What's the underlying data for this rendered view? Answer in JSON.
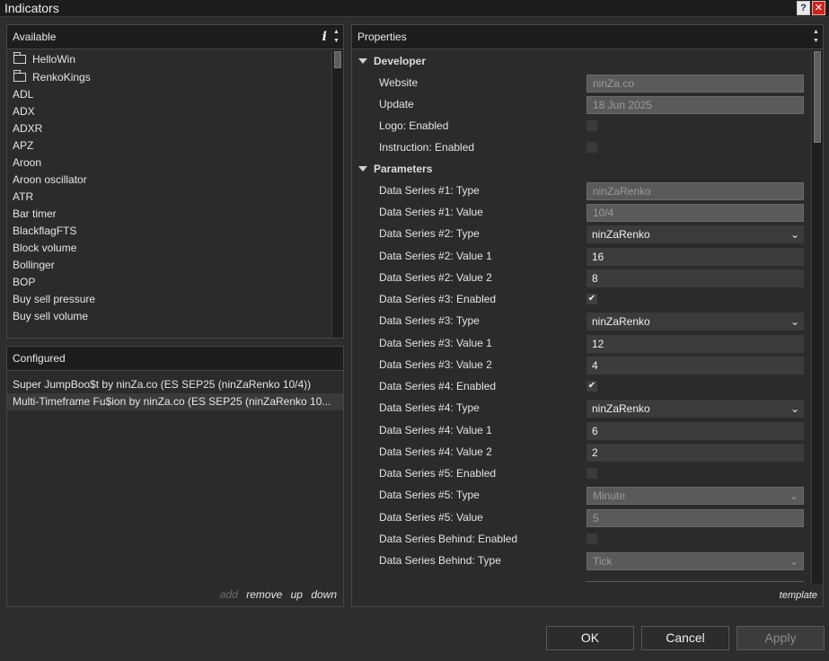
{
  "window": {
    "title": "Indicators",
    "help_icon": "?",
    "close_icon": "✕"
  },
  "available": {
    "header": "Available",
    "info_icon": "i",
    "folders": [
      "HelloWin",
      "RenkoKings"
    ],
    "items": [
      "ADL",
      "ADX",
      "ADXR",
      "APZ",
      "Aroon",
      "Aroon oscillator",
      "ATR",
      "Bar timer",
      "BlackflagFTS",
      "Block volume",
      "Bollinger",
      "BOP",
      "Buy sell pressure",
      "Buy sell volume"
    ]
  },
  "configured": {
    "header": "Configured",
    "items": [
      "Super JumpBoo$t by ninZa.co (ES SEP25 (ninZaRenko 10/4))",
      "Multi-Timeframe Fu$ion by ninZa.co (ES SEP25 (ninZaRenko 10..."
    ],
    "actions": {
      "add": "add",
      "remove": "remove",
      "up": "up",
      "down": "down"
    }
  },
  "properties": {
    "header": "Properties",
    "template_label": "template",
    "developer": {
      "section": "Developer",
      "website_label": "Website",
      "website_value": "ninZa.co",
      "update_label": "Update",
      "update_value": "18 Jun 2025",
      "logo_label": "Logo: Enabled",
      "instruction_label": "Instruction: Enabled"
    },
    "parameters": {
      "section": "Parameters",
      "ds1_type_label": "Data Series #1: Type",
      "ds1_type_value": "ninZaRenko",
      "ds1_value_label": "Data Series #1: Value",
      "ds1_value_value": "10/4",
      "ds2_type_label": "Data Series #2: Type",
      "ds2_type_value": "ninZaRenko",
      "ds2_v1_label": "Data Series #2: Value 1",
      "ds2_v1_value": "16",
      "ds2_v2_label": "Data Series #2: Value 2",
      "ds2_v2_value": "8",
      "ds3_enabled_label": "Data Series #3: Enabled",
      "ds3_type_label": "Data Series #3: Type",
      "ds3_type_value": "ninZaRenko",
      "ds3_v1_label": "Data Series #3: Value 1",
      "ds3_v1_value": "12",
      "ds3_v2_label": "Data Series #3: Value 2",
      "ds3_v2_value": "4",
      "ds4_enabled_label": "Data Series #4: Enabled",
      "ds4_type_label": "Data Series #4: Type",
      "ds4_type_value": "ninZaRenko",
      "ds4_v1_label": "Data Series #4: Value 1",
      "ds4_v1_value": "6",
      "ds4_v2_label": "Data Series #4: Value 2",
      "ds4_v2_value": "2",
      "ds5_enabled_label": "Data Series #5: Enabled",
      "ds5_type_label": "Data Series #5: Type",
      "ds5_type_value": "Minute",
      "ds5_value_label": "Data Series #5: Value",
      "ds5_value_value": "5",
      "dsb_enabled_label": "Data Series Behind: Enabled",
      "dsb_type_label": "Data Series Behind: Type",
      "dsb_type_value": "Tick"
    }
  },
  "buttons": {
    "ok": "OK",
    "cancel": "Cancel",
    "apply": "Apply"
  },
  "check_glyph": "✔",
  "chevron_glyph": "⌄"
}
